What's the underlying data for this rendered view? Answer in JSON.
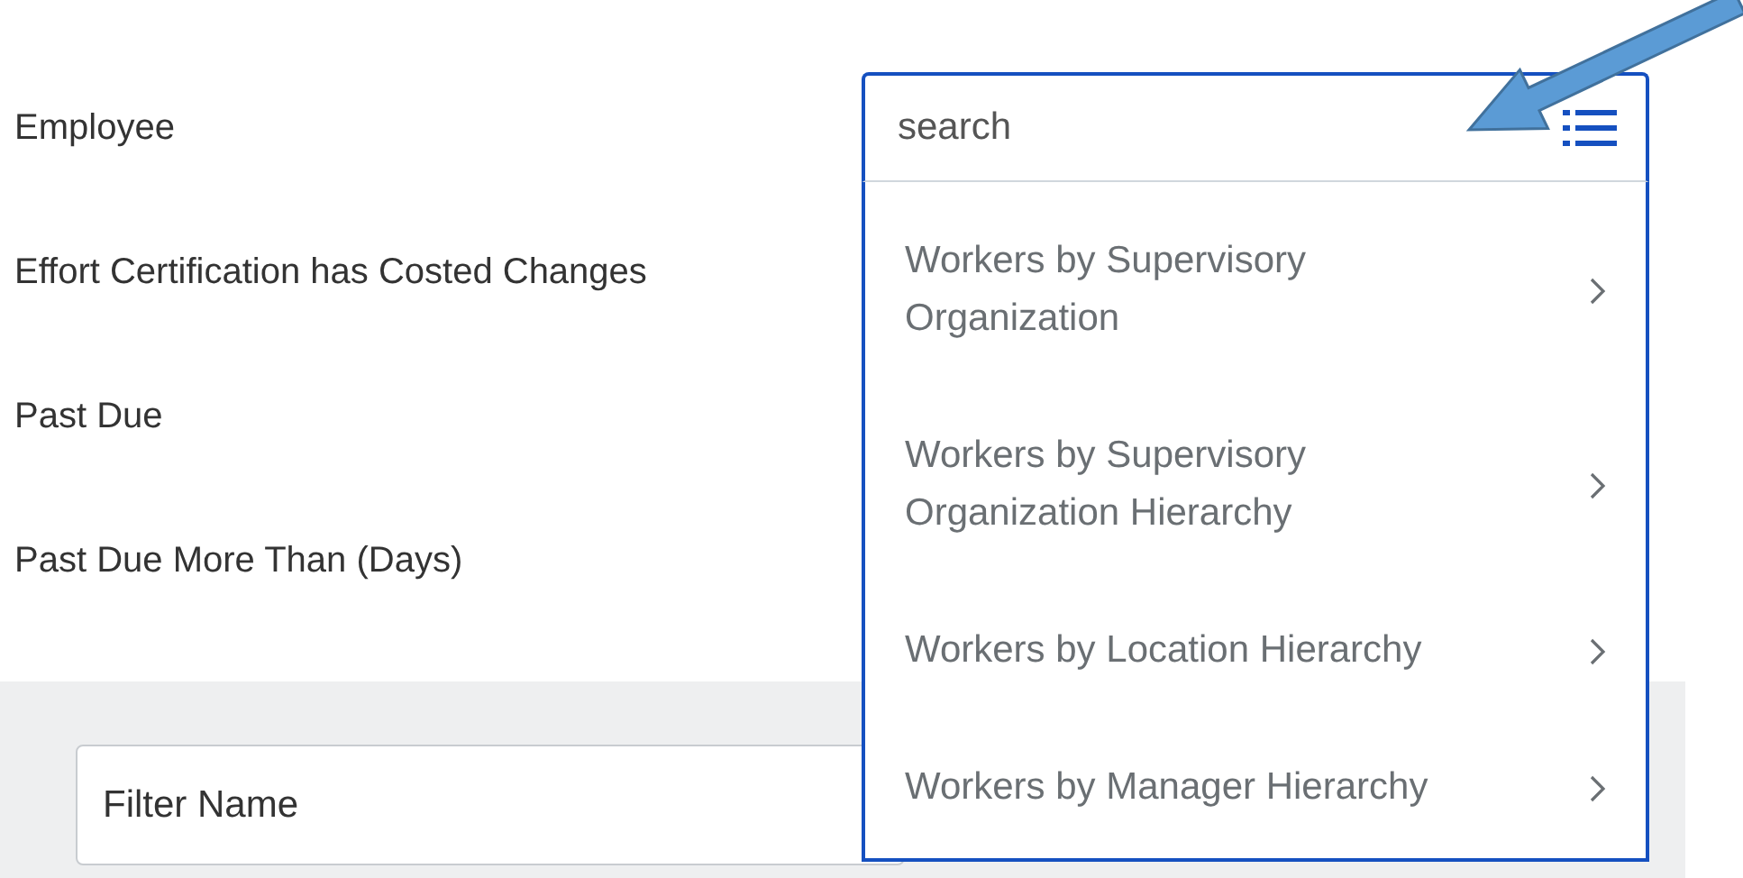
{
  "fields": [
    {
      "label": "Employee"
    },
    {
      "label": "Effort Certification has Costed Changes"
    },
    {
      "label": "Past Due"
    },
    {
      "label": "Past Due More Than (Days)"
    }
  ],
  "search": {
    "placeholder": "search"
  },
  "dropdown": {
    "items": [
      {
        "label": "Workers by Supervisory Organization"
      },
      {
        "label": "Workers by Supervisory Organization Hierarchy"
      },
      {
        "label": "Workers by Location Hierarchy"
      },
      {
        "label": "Workers by Manager Hierarchy"
      }
    ]
  },
  "filter": {
    "placeholder": "Filter Name"
  }
}
